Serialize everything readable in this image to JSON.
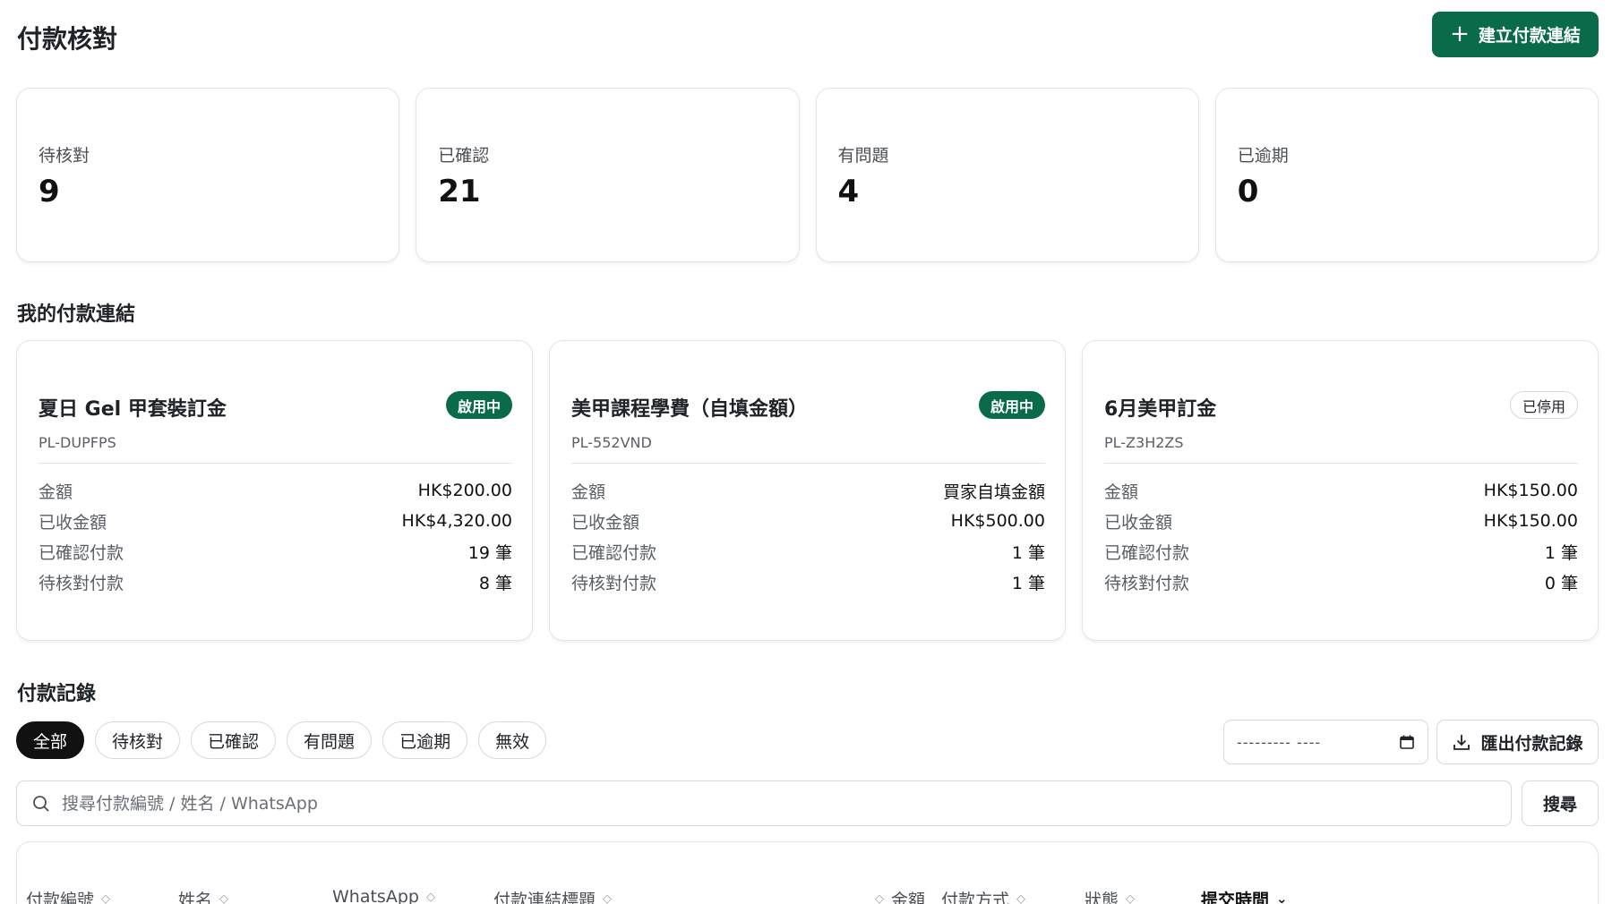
{
  "header": {
    "title": "付款核對",
    "create_button": "建立付款連結",
    "create_icon": "+"
  },
  "stats": [
    {
      "label": "待核對",
      "value": "9"
    },
    {
      "label": "已確認",
      "value": "21"
    },
    {
      "label": "有問題",
      "value": "4"
    },
    {
      "label": "已逾期",
      "value": "0"
    }
  ],
  "links_section": {
    "title": "我的付款連結",
    "row_labels": {
      "amount": "金額",
      "received": "已收金額",
      "confirmed": "已確認付款",
      "pending": "待核對付款"
    },
    "cards": [
      {
        "title": "夏日 Gel 甲套裝訂金",
        "code": "PL-DUPFPS",
        "status": "啟用中",
        "amount": "HK$200.00",
        "received": "HK$4,320.00",
        "confirmed": "19 筆",
        "pending": "8 筆"
      },
      {
        "title": "美甲課程學費（自填金額）",
        "code": "PL-552VND",
        "status": "啟用中",
        "amount": "買家自填金額",
        "received": "HK$500.00",
        "confirmed": "1 筆",
        "pending": "1 筆"
      },
      {
        "title": "6月美甲訂金",
        "code": "PL-Z3H2ZS",
        "status": "已停用",
        "amount": "HK$150.00",
        "received": "HK$150.00",
        "confirmed": "1 筆",
        "pending": "0 筆"
      }
    ]
  },
  "records_section": {
    "title": "付款記錄",
    "filters": [
      "全部",
      "待核對",
      "已確認",
      "有問題",
      "已逾期",
      "無效"
    ],
    "selected_filter": "全部",
    "date_placeholder": "--------- ----",
    "export_button": "匯出付款記錄",
    "search_placeholder": "搜尋付款編號 / 姓名 / WhatsApp",
    "search_value": "",
    "search_button": "搜尋",
    "columns": [
      "付款編號",
      "姓名",
      "WhatsApp",
      "付款連結標題",
      "金額",
      "付款方式",
      "狀態",
      "提交時間"
    ],
    "sorted_column": "提交時間"
  },
  "colors": {
    "brand_green": "#0a6b4b",
    "chip_selected": "#111111",
    "border": "#d6d9dd"
  },
  "icons": {
    "create": "plus-icon",
    "calendar": "calendar-icon",
    "export": "download-icon",
    "search": "search-icon",
    "sort": "sort-icon",
    "sort_active": "chevron-down-icon"
  }
}
